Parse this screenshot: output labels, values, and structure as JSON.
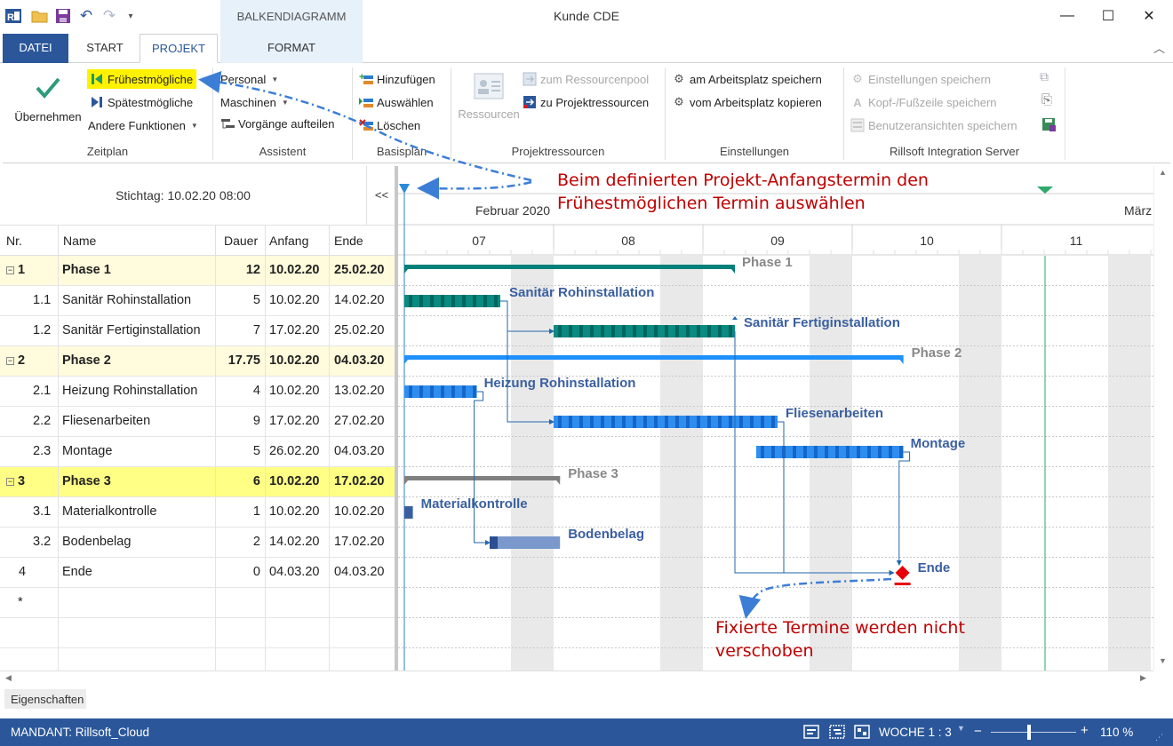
{
  "window": {
    "title": "Kunde CDE",
    "minimize_glyph": "—",
    "maximize_glyph": "☐",
    "close_glyph": "✕"
  },
  "quick_access": {
    "app_icon": "rillsoft-app-icon",
    "items": [
      "open-folder-icon",
      "save-icon",
      "undo-icon",
      "redo-icon",
      "customize-dropdown-icon"
    ]
  },
  "tabs": {
    "datei": "DATEI",
    "start": "START",
    "projekt": "PROJEKT",
    "context_header": "BALKENDIAGRAMM",
    "format": "FORMAT"
  },
  "ribbon": {
    "zeitplan": {
      "label": "Zeitplan",
      "apply": "Übernehmen",
      "fruehest": "Frühestmögliche",
      "spaetest": "Spätestmögliche",
      "andere": "Andere Funktionen"
    },
    "assistent": {
      "label": "Assistent",
      "personal": "Personal",
      "maschinen": "Maschinen",
      "vorgaenge": "Vorgänge aufteilen"
    },
    "basisplan": {
      "label": "Basisplan",
      "hinzufuegen": "Hinzufügen",
      "auswaehlen": "Auswählen",
      "loeschen": "Löschen"
    },
    "projektressourcen": {
      "label": "Projektressourcen",
      "ressourcen": "Ressourcen",
      "zum_pool": "zum Ressourcenpool",
      "zu_projekt": "zu Projektressourcen"
    },
    "einstellungen": {
      "label": "Einstellungen",
      "speichern": "am Arbeitsplatz speichern",
      "kopieren": "vom Arbeitsplatz kopieren"
    },
    "server": {
      "label": "Rillsoft Integration Server",
      "einst": "Einstellungen speichern",
      "kopf": "Kopf-/Fußzeile speichern",
      "benutzer": "Benutzeransichten speichern"
    }
  },
  "grid": {
    "stichtag": "Stichtag: 10.02.20 08:00",
    "collapse": "<<",
    "headers": {
      "nr": "Nr.",
      "name": "Name",
      "dauer": "Dauer",
      "anfang": "Anfang",
      "ende": "Ende"
    },
    "rows": [
      {
        "nr": "1",
        "name": "Phase 1",
        "dauer": "12",
        "anfang": "10.02.20",
        "ende": "25.02.20",
        "kind": "phase"
      },
      {
        "nr": "1.1",
        "name": "Sanitär Rohinstallation",
        "dauer": "5",
        "anfang": "10.02.20",
        "ende": "14.02.20",
        "kind": "task"
      },
      {
        "nr": "1.2",
        "name": "Sanitär Fertiginstallation",
        "dauer": "7",
        "anfang": "17.02.20",
        "ende": "25.02.20",
        "kind": "task"
      },
      {
        "nr": "2",
        "name": "Phase 2",
        "dauer": "17.75",
        "anfang": "10.02.20",
        "ende": "04.03.20",
        "kind": "phase"
      },
      {
        "nr": "2.1",
        "name": "Heizung Rohinstallation",
        "dauer": "4",
        "anfang": "10.02.20",
        "ende": "13.02.20",
        "kind": "task"
      },
      {
        "nr": "2.2",
        "name": "Fliesenarbeiten",
        "dauer": "9",
        "anfang": "17.02.20",
        "ende": "27.02.20",
        "kind": "task"
      },
      {
        "nr": "2.3",
        "name": "Montage",
        "dauer": "5",
        "anfang": "26.02.20",
        "ende": "04.03.20",
        "kind": "task"
      },
      {
        "nr": "3",
        "name": "Phase 3",
        "dauer": "6",
        "anfang": "10.02.20",
        "ende": "17.02.20",
        "kind": "phase3"
      },
      {
        "nr": "3.1",
        "name": "Materialkontrolle",
        "dauer": "1",
        "anfang": "10.02.20",
        "ende": "10.02.20",
        "kind": "task"
      },
      {
        "nr": "3.2",
        "name": "Bodenbelag",
        "dauer": "2",
        "anfang": "14.02.20",
        "ende": "17.02.20",
        "kind": "task"
      },
      {
        "nr": "4",
        "name": "Ende",
        "dauer": "0",
        "anfang": "04.03.20",
        "ende": "04.03.20",
        "kind": "milestone"
      }
    ],
    "new_row_marker": "*"
  },
  "timeline": {
    "month_1": "Februar 2020",
    "month_2": "März",
    "weeks": [
      "07",
      "08",
      "09",
      "10",
      "11"
    ]
  },
  "gantt": {
    "bar_labels": {
      "phase1": "Phase 1",
      "t11": "Sanitär Rohinstallation",
      "t12": "Sanitär Fertiginstallation",
      "phase2": "Phase 2",
      "t21": "Heizung Rohinstallation",
      "t22": "Fliesenarbeiten",
      "t23": "Montage",
      "phase3": "Phase 3",
      "t31": "Materialkontrolle",
      "t32": "Bodenbelag",
      "end": "Ende"
    },
    "colors": {
      "phase1": "#00807a",
      "task1": "#00756e",
      "phase2": "#1e90ff",
      "task2": "#1e7fe8",
      "phase3": "#808080",
      "task3": "#7a98cc",
      "milestone": "#e8000b",
      "today": "#2eaa6a",
      "label": "#3a5fa0",
      "phase_label": "#888888"
    }
  },
  "annotations": {
    "top_line1": "Beim definierten Projekt-Anfangstermin den",
    "top_line2": "Frühestmöglichen Termin auswählen",
    "bottom_line1": "Fixierte Termine werden nicht",
    "bottom_line2": "verschoben"
  },
  "properties_tab": "Eigenschaften",
  "status": {
    "mandant": "MANDANT: Rillsoft_Cloud",
    "woche": "WOCHE 1 : 3",
    "zoom": "110 %",
    "zoom_minus": "−",
    "zoom_plus": "+"
  }
}
